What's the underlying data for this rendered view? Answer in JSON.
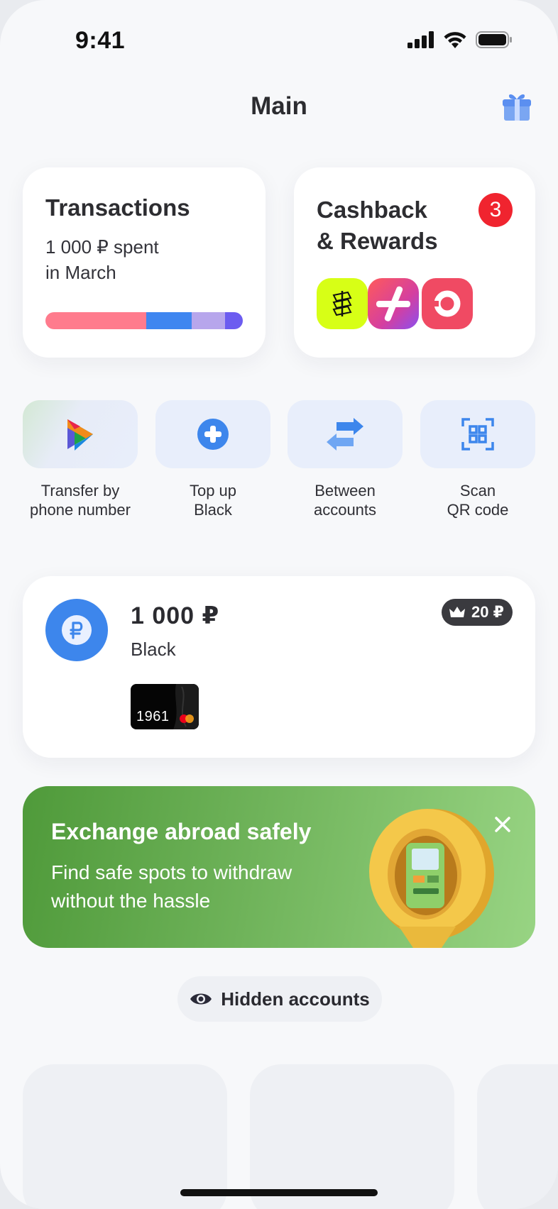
{
  "status_bar": {
    "time": "9:41"
  },
  "header": {
    "title": "Main",
    "gift_icon": "gift-icon"
  },
  "transactions": {
    "title": "Transactions",
    "subtitle": "1 000 ₽ spent\nin March",
    "bar_segments": [
      {
        "color": "#ff7b8d",
        "share": 0.51
      },
      {
        "color": "#3f86f0",
        "share": 0.23
      },
      {
        "color": "#b7a6ec",
        "share": 0.17
      },
      {
        "color": "#6c5cf0",
        "share": 0.09
      }
    ]
  },
  "cashback": {
    "title": "Cashback\n& Rewards",
    "badge": "3",
    "partners": [
      {
        "name": "partner-lime-icon",
        "color": "#d7ff16"
      },
      {
        "name": "partner-pink-plus-icon",
        "color": "#e8467c"
      },
      {
        "name": "partner-red-circle-icon",
        "color": "#f04a63"
      }
    ]
  },
  "quick_actions": [
    {
      "label": "Transfer by\nphone number",
      "icon": "sbp-icon"
    },
    {
      "label": "Top up\nBlack",
      "icon": "plus-circle-icon"
    },
    {
      "label": "Between\naccounts",
      "icon": "exchange-arrows-icon"
    },
    {
      "label": "Scan\nQR code",
      "icon": "qr-scan-icon"
    }
  ],
  "account": {
    "amount": "1 000 ₽",
    "name": "Black",
    "cashback": "20 ₽",
    "card_number": "1961",
    "icon": "ruble-icon"
  },
  "banner": {
    "title": "Exchange abroad safely",
    "text": "Find safe spots to withdraw\nwithout the hassle",
    "close_icon": "close-icon"
  },
  "hidden_accounts": {
    "label": "Hidden accounts",
    "icon": "eye-icon"
  },
  "colors": {
    "accent": "#3d86ec",
    "badge": "#f0242f",
    "banner_green": "#5aa544"
  }
}
